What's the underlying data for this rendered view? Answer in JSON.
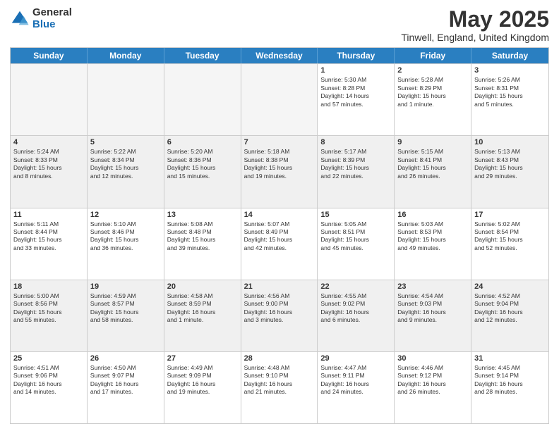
{
  "logo": {
    "general": "General",
    "blue": "Blue"
  },
  "header": {
    "month": "May 2025",
    "location": "Tinwell, England, United Kingdom"
  },
  "weekdays": [
    "Sunday",
    "Monday",
    "Tuesday",
    "Wednesday",
    "Thursday",
    "Friday",
    "Saturday"
  ],
  "rows": [
    [
      {
        "day": "",
        "info": "",
        "empty": true
      },
      {
        "day": "",
        "info": "",
        "empty": true
      },
      {
        "day": "",
        "info": "",
        "empty": true
      },
      {
        "day": "",
        "info": "",
        "empty": true
      },
      {
        "day": "1",
        "info": "Sunrise: 5:30 AM\nSunset: 8:28 PM\nDaylight: 14 hours\nand 57 minutes."
      },
      {
        "day": "2",
        "info": "Sunrise: 5:28 AM\nSunset: 8:29 PM\nDaylight: 15 hours\nand 1 minute."
      },
      {
        "day": "3",
        "info": "Sunrise: 5:26 AM\nSunset: 8:31 PM\nDaylight: 15 hours\nand 5 minutes."
      }
    ],
    [
      {
        "day": "4",
        "info": "Sunrise: 5:24 AM\nSunset: 8:33 PM\nDaylight: 15 hours\nand 8 minutes."
      },
      {
        "day": "5",
        "info": "Sunrise: 5:22 AM\nSunset: 8:34 PM\nDaylight: 15 hours\nand 12 minutes."
      },
      {
        "day": "6",
        "info": "Sunrise: 5:20 AM\nSunset: 8:36 PM\nDaylight: 15 hours\nand 15 minutes."
      },
      {
        "day": "7",
        "info": "Sunrise: 5:18 AM\nSunset: 8:38 PM\nDaylight: 15 hours\nand 19 minutes."
      },
      {
        "day": "8",
        "info": "Sunrise: 5:17 AM\nSunset: 8:39 PM\nDaylight: 15 hours\nand 22 minutes."
      },
      {
        "day": "9",
        "info": "Sunrise: 5:15 AM\nSunset: 8:41 PM\nDaylight: 15 hours\nand 26 minutes."
      },
      {
        "day": "10",
        "info": "Sunrise: 5:13 AM\nSunset: 8:43 PM\nDaylight: 15 hours\nand 29 minutes."
      }
    ],
    [
      {
        "day": "11",
        "info": "Sunrise: 5:11 AM\nSunset: 8:44 PM\nDaylight: 15 hours\nand 33 minutes."
      },
      {
        "day": "12",
        "info": "Sunrise: 5:10 AM\nSunset: 8:46 PM\nDaylight: 15 hours\nand 36 minutes."
      },
      {
        "day": "13",
        "info": "Sunrise: 5:08 AM\nSunset: 8:48 PM\nDaylight: 15 hours\nand 39 minutes."
      },
      {
        "day": "14",
        "info": "Sunrise: 5:07 AM\nSunset: 8:49 PM\nDaylight: 15 hours\nand 42 minutes."
      },
      {
        "day": "15",
        "info": "Sunrise: 5:05 AM\nSunset: 8:51 PM\nDaylight: 15 hours\nand 45 minutes."
      },
      {
        "day": "16",
        "info": "Sunrise: 5:03 AM\nSunset: 8:53 PM\nDaylight: 15 hours\nand 49 minutes."
      },
      {
        "day": "17",
        "info": "Sunrise: 5:02 AM\nSunset: 8:54 PM\nDaylight: 15 hours\nand 52 minutes."
      }
    ],
    [
      {
        "day": "18",
        "info": "Sunrise: 5:00 AM\nSunset: 8:56 PM\nDaylight: 15 hours\nand 55 minutes."
      },
      {
        "day": "19",
        "info": "Sunrise: 4:59 AM\nSunset: 8:57 PM\nDaylight: 15 hours\nand 58 minutes."
      },
      {
        "day": "20",
        "info": "Sunrise: 4:58 AM\nSunset: 8:59 PM\nDaylight: 16 hours\nand 1 minute."
      },
      {
        "day": "21",
        "info": "Sunrise: 4:56 AM\nSunset: 9:00 PM\nDaylight: 16 hours\nand 3 minutes."
      },
      {
        "day": "22",
        "info": "Sunrise: 4:55 AM\nSunset: 9:02 PM\nDaylight: 16 hours\nand 6 minutes."
      },
      {
        "day": "23",
        "info": "Sunrise: 4:54 AM\nSunset: 9:03 PM\nDaylight: 16 hours\nand 9 minutes."
      },
      {
        "day": "24",
        "info": "Sunrise: 4:52 AM\nSunset: 9:04 PM\nDaylight: 16 hours\nand 12 minutes."
      }
    ],
    [
      {
        "day": "25",
        "info": "Sunrise: 4:51 AM\nSunset: 9:06 PM\nDaylight: 16 hours\nand 14 minutes."
      },
      {
        "day": "26",
        "info": "Sunrise: 4:50 AM\nSunset: 9:07 PM\nDaylight: 16 hours\nand 17 minutes."
      },
      {
        "day": "27",
        "info": "Sunrise: 4:49 AM\nSunset: 9:09 PM\nDaylight: 16 hours\nand 19 minutes."
      },
      {
        "day": "28",
        "info": "Sunrise: 4:48 AM\nSunset: 9:10 PM\nDaylight: 16 hours\nand 21 minutes."
      },
      {
        "day": "29",
        "info": "Sunrise: 4:47 AM\nSunset: 9:11 PM\nDaylight: 16 hours\nand 24 minutes."
      },
      {
        "day": "30",
        "info": "Sunrise: 4:46 AM\nSunset: 9:12 PM\nDaylight: 16 hours\nand 26 minutes."
      },
      {
        "day": "31",
        "info": "Sunrise: 4:45 AM\nSunset: 9:14 PM\nDaylight: 16 hours\nand 28 minutes."
      }
    ]
  ]
}
